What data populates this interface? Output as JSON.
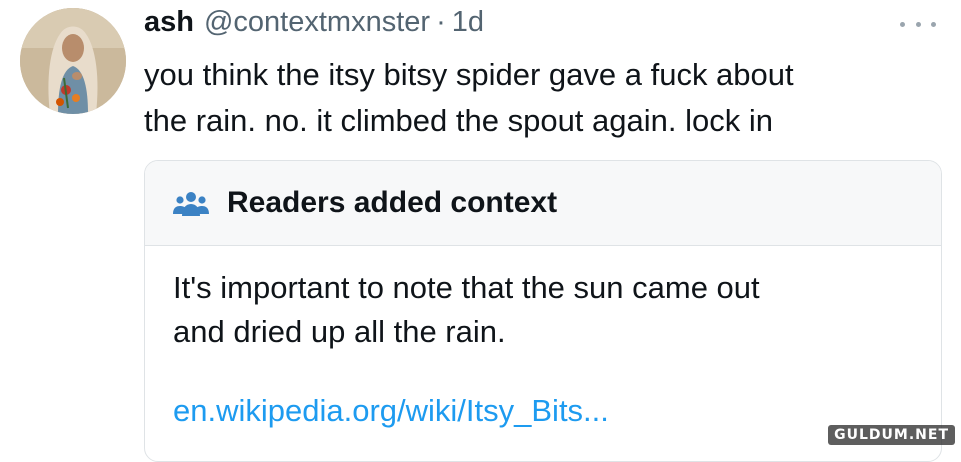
{
  "tweet": {
    "display_name": "ash",
    "handle": "@contextmxnster",
    "separator": "·",
    "time": "1d",
    "text_lines": [
      "you think the itsy bitsy spider gave a fuck about",
      "the rain. no. it climbed the spout again. lock in"
    ]
  },
  "context_note": {
    "title": "Readers added context",
    "icon": "readers-group-icon",
    "body_lines": [
      "It's important to note that the sun came out",
      "and dried up all the rain."
    ],
    "link": "en.wikipedia.org/wiki/Itsy_Bits..."
  },
  "more_icon": "ellipsis-icon",
  "watermark": "GULDUM.NET",
  "colors": {
    "text": "#0f1419",
    "secondary": "#536471",
    "link": "#1d9bf0",
    "border": "#dfe3e6",
    "header_bg": "#f7f8f9"
  }
}
